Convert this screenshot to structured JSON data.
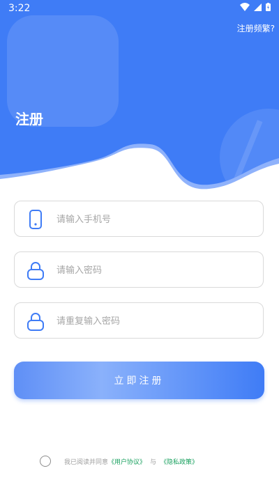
{
  "status": {
    "time": "3:22"
  },
  "header": {
    "frequent_link": "注册频繁?",
    "title": "注册"
  },
  "form": {
    "phone_placeholder": "请输入手机号",
    "password_placeholder": "请输入密码",
    "confirm_placeholder": "请重复输入密码",
    "submit_label": "立即注册"
  },
  "agreement": {
    "text": "我已阅读并同意",
    "user_agreement": "《用户协议》",
    "and": "与",
    "privacy_policy": "《隐私政策》"
  },
  "colors": {
    "primary": "#3f7cf6",
    "link": "#18a05e",
    "border": "#d9d9d9"
  },
  "icons": [
    "wifi-icon",
    "signal-icon",
    "battery-icon",
    "phone-icon",
    "lock-icon"
  ]
}
